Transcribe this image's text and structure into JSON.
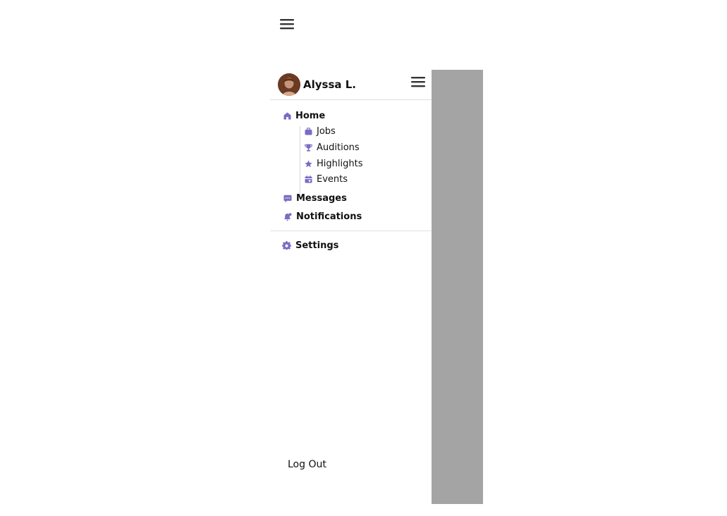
{
  "user": {
    "name": "Alyssa L."
  },
  "nav": {
    "home": "Home",
    "jobs": "Jobs",
    "auditions": "Auditions",
    "highlights": "Highlights",
    "events": "Events",
    "messages": "Messages",
    "notifications": "Notifications",
    "settings": "Settings"
  },
  "footer": {
    "logout": "Log Out"
  },
  "icons": {
    "home": "home-icon",
    "jobs": "briefcase-icon",
    "auditions": "trophy-icon",
    "highlights": "star-icon",
    "events": "calendar-icon",
    "messages": "message-icon",
    "notifications": "bell-icon",
    "settings": "gear-icon",
    "menu": "hamburger-menu-icon"
  },
  "colors": {
    "accent": "#7b6bc6",
    "overlay": "#a4a4a4",
    "text": "#111111"
  }
}
